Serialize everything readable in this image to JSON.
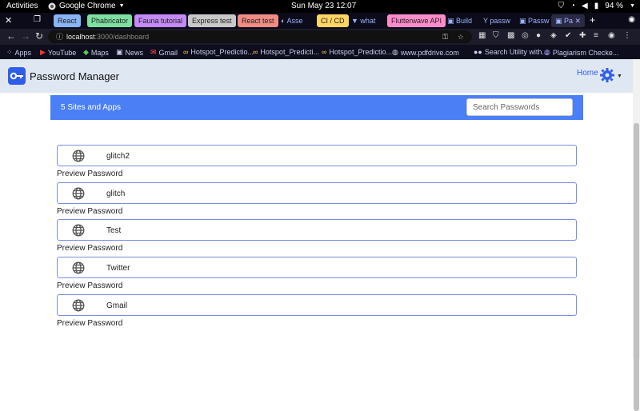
{
  "system": {
    "activities": "Activities",
    "app_name": "Google Chrome",
    "clock": "Sun May 23  12:07",
    "battery": "94 %"
  },
  "tabs": [
    {
      "label": "React",
      "color": "#8ab4f8"
    },
    {
      "label": "Phabricator",
      "color": "#7ee0a0"
    },
    {
      "label": "Fauna tutorial",
      "color": "#c58af9"
    },
    {
      "label": "Express test",
      "color": "#c8c8c8"
    },
    {
      "label": "React test",
      "color": "#f28b82"
    },
    {
      "label": "Asse",
      "color": ""
    },
    {
      "label": "CI / CD",
      "color": "#fdd663"
    },
    {
      "label": "what",
      "color": ""
    },
    {
      "label": "Flutterwave API",
      "color": "#ff8bcb"
    },
    {
      "label": "Build",
      "color": ""
    },
    {
      "label": "passw",
      "color": ""
    },
    {
      "label": "Passw",
      "color": ""
    },
    {
      "label": "Pa",
      "color": ""
    }
  ],
  "address": {
    "host": "localhost",
    "path": ":3000/dashboard"
  },
  "bookmarks": [
    "Apps",
    "YouTube",
    "Maps",
    "News",
    "Gmail",
    "Hotspot_Predictio...",
    "Hotspot_Predicti...",
    "Hotspot_Predictio...",
    "www.pdfdrive.com",
    "Search Utility with...",
    "Plagiarism Checke..."
  ],
  "app": {
    "title": "Password Manager",
    "home": "Home",
    "accent": "#2f5fe8",
    "panel_color": "#4a7ff6"
  },
  "panel": {
    "count_label": "5 Sites and Apps",
    "search_placeholder": "Search Passwords"
  },
  "entries": [
    {
      "name": "glitch2",
      "preview": "Preview Password"
    },
    {
      "name": "glitch",
      "preview": "Preview Password"
    },
    {
      "name": "Test",
      "preview": "Preview Password"
    },
    {
      "name": "Twitter",
      "preview": "Preview Password"
    },
    {
      "name": "Gmail",
      "preview": "Preview Password"
    }
  ]
}
